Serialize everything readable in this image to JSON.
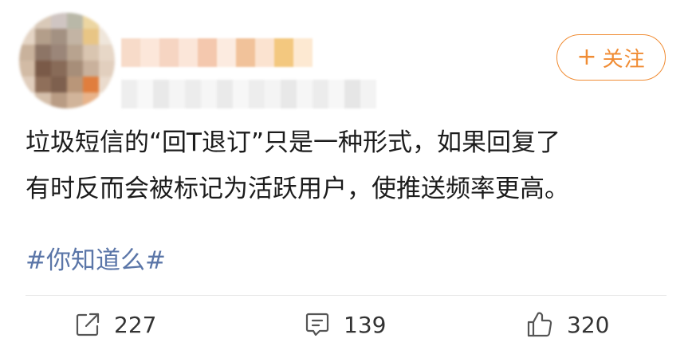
{
  "post": {
    "text_line1": "垃圾短信的“回T退订”只是一种形式，如果回复了",
    "text_line2": "有时反而会被标记为活跃用户，使推送频率更高。",
    "topic": "#你知道么#"
  },
  "follow_button": {
    "plus": "+",
    "label": "关注"
  },
  "actions": {
    "share_count": "227",
    "comment_count": "139",
    "like_count": "320"
  },
  "icons": {
    "share": "share-icon",
    "comment": "comment-icon",
    "like": "thumbs-up-icon"
  },
  "colors": {
    "accent": "#f08c34",
    "topic": "#5b76a8",
    "text": "#1c1c1c"
  }
}
